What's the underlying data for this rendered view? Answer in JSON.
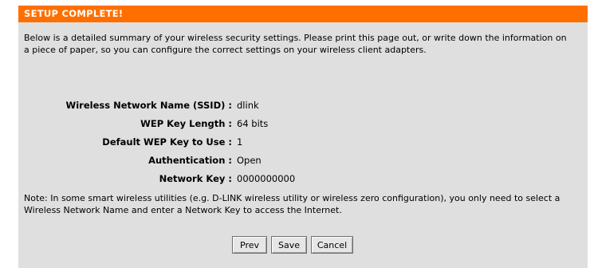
{
  "header": {
    "title": "SETUP COMPLETE!"
  },
  "intro_text": "Below is a detailed summary of your wireless security settings. Please print this page out, or write down the information on a piece of paper, so you can configure the correct settings on your wireless client adapters.",
  "settings": [
    {
      "label": "Wireless Network Name (SSID) :",
      "value": "dlink"
    },
    {
      "label": "WEP Key Length :",
      "value": "64 bits"
    },
    {
      "label": "Default WEP Key to Use :",
      "value": "1"
    },
    {
      "label": "Authentication :",
      "value": "Open"
    },
    {
      "label": "Network Key :",
      "value": "0000000000"
    }
  ],
  "note_text": "Note: In some smart wireless utilities (e.g. D-LINK wireless utility or wireless zero configuration), you only need to select a Wireless Network Name and enter a Network Key to access the Internet.",
  "buttons": {
    "prev": "Prev",
    "save": "Save",
    "cancel": "Cancel"
  },
  "colors": {
    "header_bg": "#ff6f00",
    "panel_bg": "#dfdfdf"
  }
}
